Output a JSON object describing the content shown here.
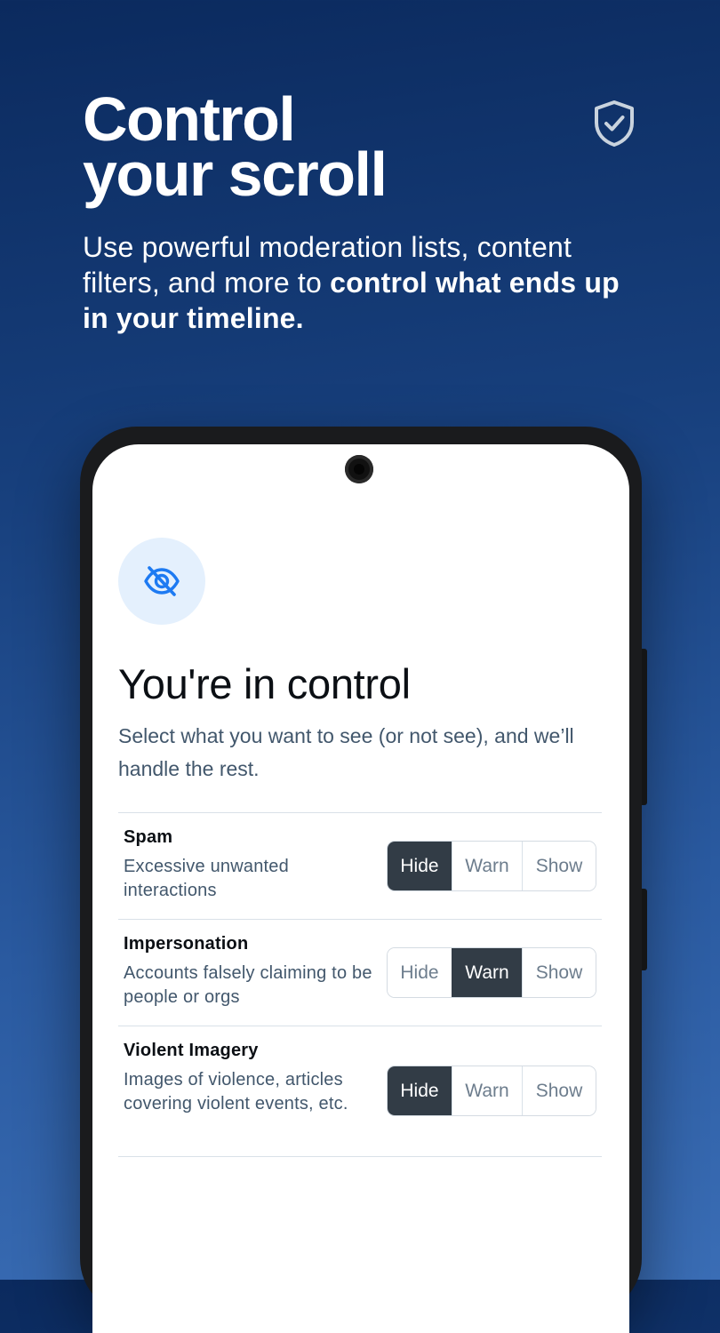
{
  "headline": {
    "line1": "Control",
    "line2": "your scroll"
  },
  "subtitle": {
    "plain": "Use powerful moderation lists, content filters, and more to ",
    "bold": "control what ends up in your timeline."
  },
  "header_icon": "shield-check-icon",
  "screen": {
    "feature_icon": "eye-slash-icon",
    "title": "You're in control",
    "description": "Select what you want to see (or not see), and we’ll handle the rest.",
    "options": [
      "Hide",
      "Warn",
      "Show"
    ],
    "rows": [
      {
        "title": "Spam",
        "description": "Excessive unwanted interactions",
        "selected": "Hide"
      },
      {
        "title": "Impersonation",
        "description": "Accounts falsely claiming to be people or orgs",
        "selected": "Warn"
      },
      {
        "title": "Violent Imagery",
        "description": "Images of violence, articles covering violent events, etc.",
        "selected": "Hide"
      }
    ]
  },
  "colors": {
    "background_top": "#0b2a5e",
    "background_bottom": "#3a6db5",
    "accent": "#1d7af2",
    "icon_circle": "#e4f0fd",
    "selected_segment": "#323c46",
    "muted_text": "#42576c"
  }
}
